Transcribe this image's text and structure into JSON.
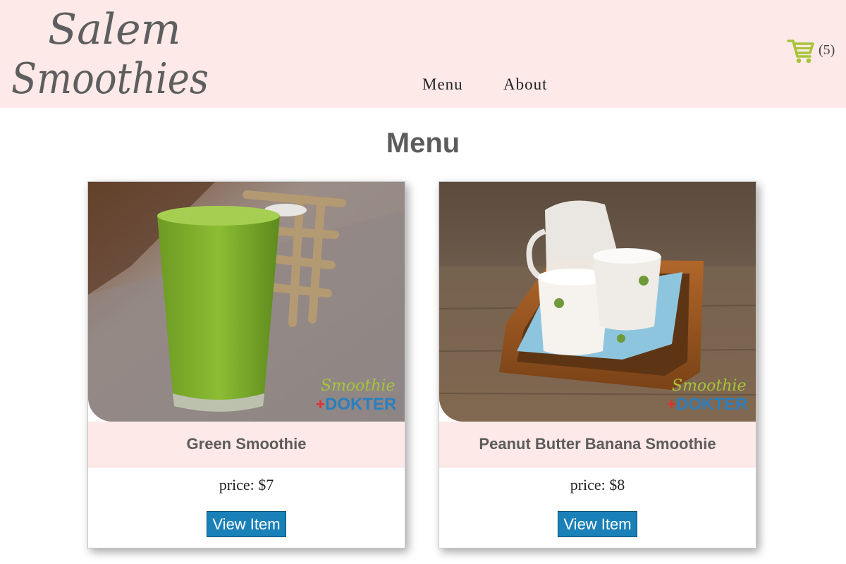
{
  "brand": {
    "line1": "Salem",
    "line2": "Smoothies"
  },
  "nav": {
    "items": [
      {
        "label": "Menu"
      },
      {
        "label": "About"
      }
    ]
  },
  "cart": {
    "icon": "shopping-cart-icon",
    "count": "(5)",
    "color": "#a7c43a"
  },
  "page": {
    "title": "Menu"
  },
  "items": [
    {
      "name": "Green Smoothie",
      "price": "price: $7",
      "button_label": "View Item",
      "watermark_line1": "Smoothie",
      "watermark_line2": "DOKTER"
    },
    {
      "name": "Peanut Butter Banana Smoothie",
      "price": "price: $8",
      "button_label": "View Item",
      "watermark_line1": "Smoothie",
      "watermark_line2": "DOKTER"
    }
  ],
  "colors": {
    "header_bg": "#fde9e8",
    "button_bg": "#1a80b8",
    "title_text": "#5c5c5c"
  }
}
